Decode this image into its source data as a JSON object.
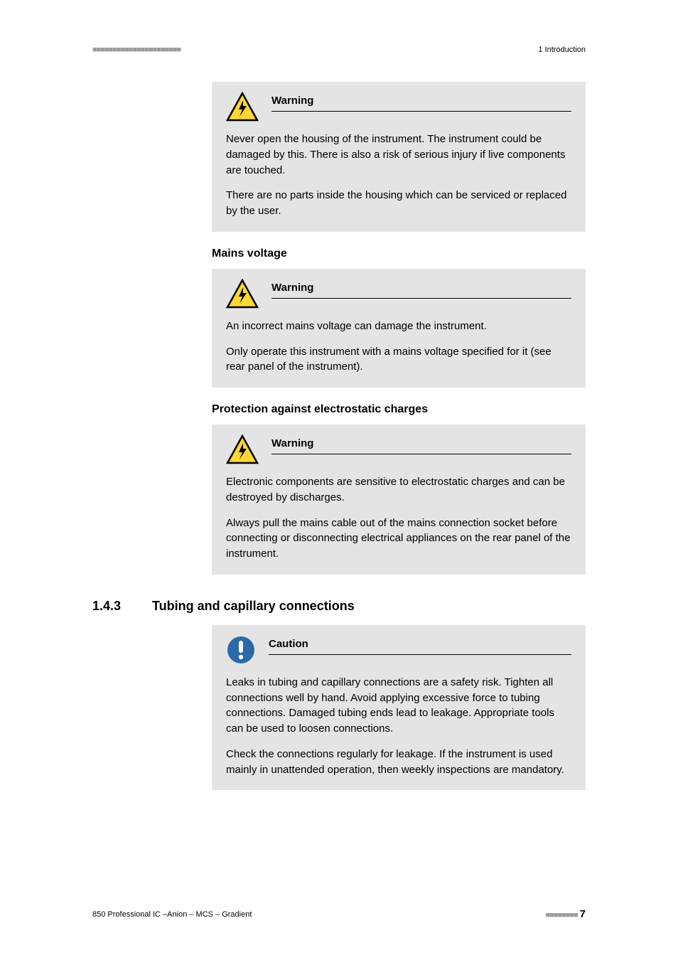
{
  "header": {
    "right": "1 Introduction"
  },
  "callouts": {
    "w1": {
      "title": "Warning",
      "p1": "Never open the housing of the instrument. The instrument could be damaged by this. There is also a risk of serious injury if live components are touched.",
      "p2": "There are no parts inside the housing which can be serviced or replaced by the user."
    },
    "mains_heading": "Mains voltage",
    "w2": {
      "title": "Warning",
      "p1": "An incorrect mains voltage can damage the instrument.",
      "p2": "Only operate this instrument with a mains voltage specified for it (see rear panel of the instrument)."
    },
    "esd_heading": "Protection against electrostatic charges",
    "w3": {
      "title": "Warning",
      "p1": "Electronic components are sensitive to electrostatic charges and can be destroyed by discharges.",
      "p2": "Always pull the mains cable out of the mains connection socket before connecting or disconnecting electrical appliances on the rear panel of the instrument."
    }
  },
  "section": {
    "num": "1.4.3",
    "title": "Tubing and capillary connections"
  },
  "caution": {
    "title": "Caution",
    "p1": "Leaks in tubing and capillary connections are a safety risk. Tighten all connections well by hand. Avoid applying excessive force to tubing connections. Damaged tubing ends lead to leakage. Appropriate tools can be used to loosen connections.",
    "p2": "Check the connections regularly for leakage. If the instrument is used mainly in unattended operation, then weekly inspections are mandatory."
  },
  "footer": {
    "left": "850 Professional IC –Anion – MCS – Gradient",
    "page": "7"
  }
}
